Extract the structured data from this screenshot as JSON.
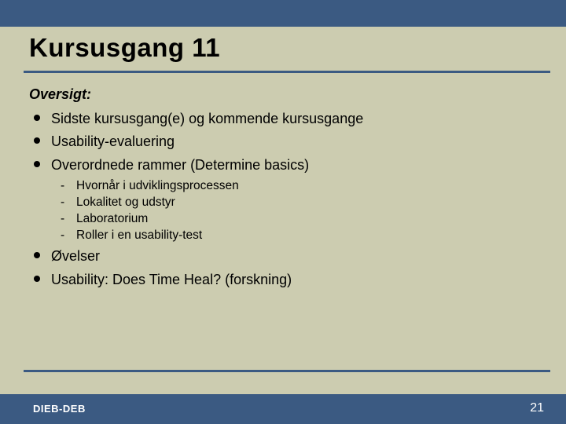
{
  "title": "Kursusgang 11",
  "overview_label": "Oversigt:",
  "bullets": [
    {
      "text": "Sidste kursusgang(e) og kommende kursusgange"
    },
    {
      "text": "Usability-evaluering"
    },
    {
      "text": "Overordnede rammer (Determine basics)",
      "sub": [
        "Hvornår i udviklingsprocessen",
        "Lokalitet og udstyr",
        "Laboratorium",
        "Roller i en usability-test"
      ]
    },
    {
      "text": "Øvelser"
    },
    {
      "text": "Usability: Does Time Heal? (forskning)"
    }
  ],
  "footer": {
    "left": "DIEB-DEB",
    "page": "21"
  },
  "colors": {
    "band": "#3b5a82",
    "background": "#ccccb0"
  }
}
